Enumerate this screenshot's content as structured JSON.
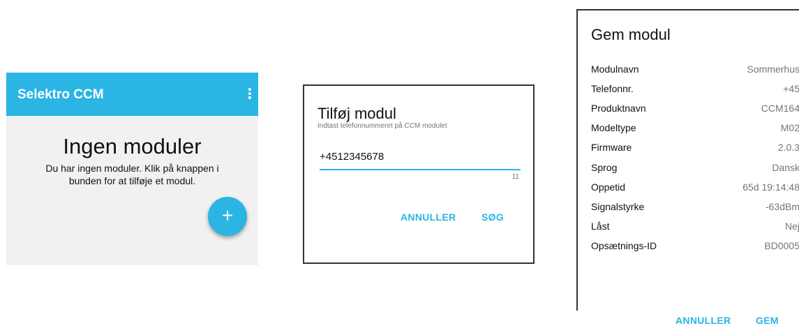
{
  "home": {
    "app_title": "Selektro CCM",
    "menu_icon": "⋮",
    "heading": "Ingen moduler",
    "message": "Du har ingen moduler. Klik på knappen i bunden for at tilføje et modul.",
    "fab_icon": "+",
    "accent_color": "#2ab5e5"
  },
  "add_dialog": {
    "title": "Tilføj modul",
    "subtitle": "Indtast telefonnummeret på CCM modulet",
    "phone_value": "+4512345678",
    "char_count": "11",
    "cancel_label": "ANNULLER",
    "search_label": "SØG"
  },
  "save_dialog": {
    "title": "Gem modul",
    "rows": [
      {
        "label": "Modulnavn",
        "value": "Sommerhus"
      },
      {
        "label": "Telefonnr.",
        "value": "+45"
      },
      {
        "label": "Produktnavn",
        "value": "CCM164"
      },
      {
        "label": "Modeltype",
        "value": "M02"
      },
      {
        "label": "Firmware",
        "value": "2.0.3"
      },
      {
        "label": "Sprog",
        "value": "Dansk"
      },
      {
        "label": "Oppetid",
        "value": "65d 19:14:48"
      },
      {
        "label": "Signalstyrke",
        "value": "-63dBm"
      },
      {
        "label": "Låst",
        "value": "Nej"
      },
      {
        "label": "Opsætnings-ID",
        "value": "BD0005"
      }
    ],
    "cancel_label": "ANNULLER",
    "save_label": "GEM"
  }
}
